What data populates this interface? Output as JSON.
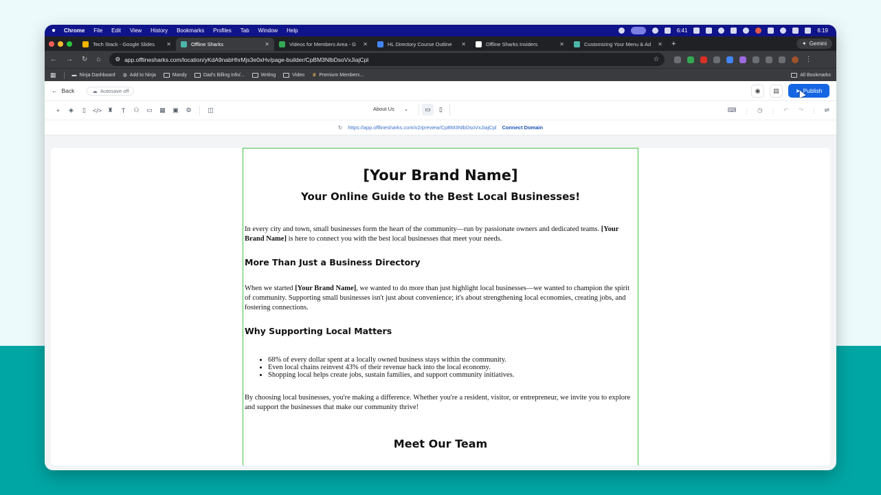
{
  "menubar": {
    "apple": "",
    "app": "Chrome",
    "items": [
      "File",
      "Edit",
      "View",
      "History",
      "Bookmarks",
      "Profiles",
      "Tab",
      "Window",
      "Help"
    ],
    "battery_time": "6:41",
    "clock": "6:19"
  },
  "tabs": [
    {
      "title": "Tech Stack - Google Slides",
      "color": "#f4b400",
      "active": false
    },
    {
      "title": "Offline Sharks",
      "color": "#4db6ac",
      "active": true
    },
    {
      "title": "Videos for Members Area - G",
      "color": "#34a853",
      "active": false
    },
    {
      "title": "HL Directory Course Outline",
      "color": "#4285f4",
      "active": false
    },
    {
      "title": "Offline Sharks Insiders",
      "color": "#ffffff",
      "active": false
    },
    {
      "title": "Customizing Your Menu & Ad",
      "color": "#4db6ac",
      "active": false
    }
  ],
  "gemini_label": "Gemini",
  "address": {
    "url": "app.offlinesharks.com/location/yKdA9nabHhrMjs3e0xHv/page-builder/CpBM3NlbDsoVxJiajCpl"
  },
  "bookmarks": [
    {
      "label": "Ninja Dashboard"
    },
    {
      "label": "Add to Ninja"
    },
    {
      "label": "Mandy"
    },
    {
      "label": "Dad's Billing Info/..."
    },
    {
      "label": "Writing"
    },
    {
      "label": "Video"
    },
    {
      "label": "Premium Members..."
    }
  ],
  "all_bookmarks": "All Bookmarks",
  "builder": {
    "back_label": "Back",
    "autosave_label": "Autosave off",
    "publish_label": "Publish",
    "page_select": "About Us",
    "preview_url": "https://app.offlinesharks.com/v2/preview/CpBM3NlbDsoVxJiajCpl",
    "connect_domain": "Connect Domain"
  },
  "content": {
    "brand_title": "[Your Brand Name]",
    "tagline": "Your Online Guide to the Best Local Businesses!",
    "intro_1": "In every city and town, small businesses form the heart of the community—run by passionate owners and dedicated teams. ",
    "intro_brand": "[Your Brand Name]",
    "intro_2": " is here to connect you with the best local businesses that meet your needs.",
    "h_directory": "More Than Just a Business Directory",
    "dir_1": "When we started ",
    "dir_brand": "[Your Brand Name]",
    "dir_2": ", we wanted to do more than just highlight local businesses—we wanted to champion the spirit of community. Supporting small businesses isn't just about convenience; it's about strengthening local economies, creating jobs, and fostering connections.",
    "h_local": "Why Supporting Local Matters",
    "bullets": [
      "68% of every dollar spent at a locally owned business stays within the community.",
      "Even local chains reinvest 43% of their revenue back into the local economy.",
      "Shopping local helps create jobs, sustain families, and support community initiatives."
    ],
    "closing": "By choosing local businesses, you're making a difference. Whether you're a resident, visitor, or entrepreneur, we invite you to explore and support the businesses that make our community thrive!",
    "h_team": "Meet Our Team"
  }
}
